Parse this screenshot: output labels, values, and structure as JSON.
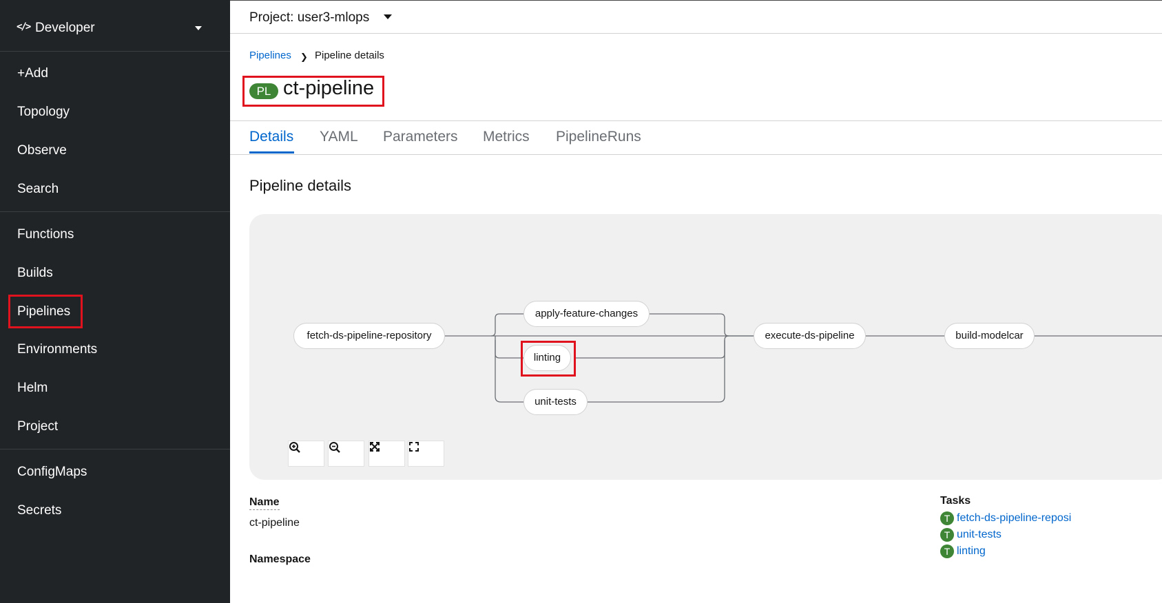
{
  "sidebar": {
    "perspective": {
      "icon": "code-icon",
      "label": "Developer"
    },
    "items": [
      {
        "label": "+Add"
      },
      {
        "label": "Topology"
      },
      {
        "label": "Observe"
      },
      {
        "label": "Search"
      },
      {
        "label": "Functions"
      },
      {
        "label": "Builds"
      },
      {
        "label": "Pipelines",
        "highlighted": true
      },
      {
        "label": "Environments"
      },
      {
        "label": "Helm"
      },
      {
        "label": "Project"
      },
      {
        "label": "ConfigMaps"
      },
      {
        "label": "Secrets"
      }
    ]
  },
  "header": {
    "project_label": "Project: user3-mlops"
  },
  "breadcrumb": {
    "link": "Pipelines",
    "current": "Pipeline details"
  },
  "page": {
    "badge": "PL",
    "title": "ct-pipeline",
    "section_title": "Pipeline details"
  },
  "tabs": [
    {
      "label": "Details",
      "active": true
    },
    {
      "label": "YAML"
    },
    {
      "label": "Parameters"
    },
    {
      "label": "Metrics"
    },
    {
      "label": "PipelineRuns"
    }
  ],
  "graph": {
    "nodes": {
      "fetch": "fetch-ds-pipeline-repository",
      "apply": "apply-feature-changes",
      "linting": "linting",
      "unit_tests": "unit-tests",
      "execute": "execute-ds-pipeline",
      "build": "build-modelcar"
    },
    "controls": [
      "zoom-in-icon",
      "zoom-out-icon",
      "fit-to-screen-icon",
      "expand-icon"
    ]
  },
  "details": {
    "name_label": "Name",
    "name_value": "ct-pipeline",
    "namespace_label": "Namespace",
    "tasks_label": "Tasks",
    "tasks": [
      {
        "badge": "T",
        "name": "fetch-ds-pipeline-reposi"
      },
      {
        "badge": "T",
        "name": "unit-tests"
      },
      {
        "badge": "T",
        "name": "linting"
      }
    ]
  },
  "colors": {
    "sidebar_bg": "#212427",
    "link": "#0066cc",
    "badge_green": "#3e8635",
    "highlight_red": "#e0121d"
  }
}
